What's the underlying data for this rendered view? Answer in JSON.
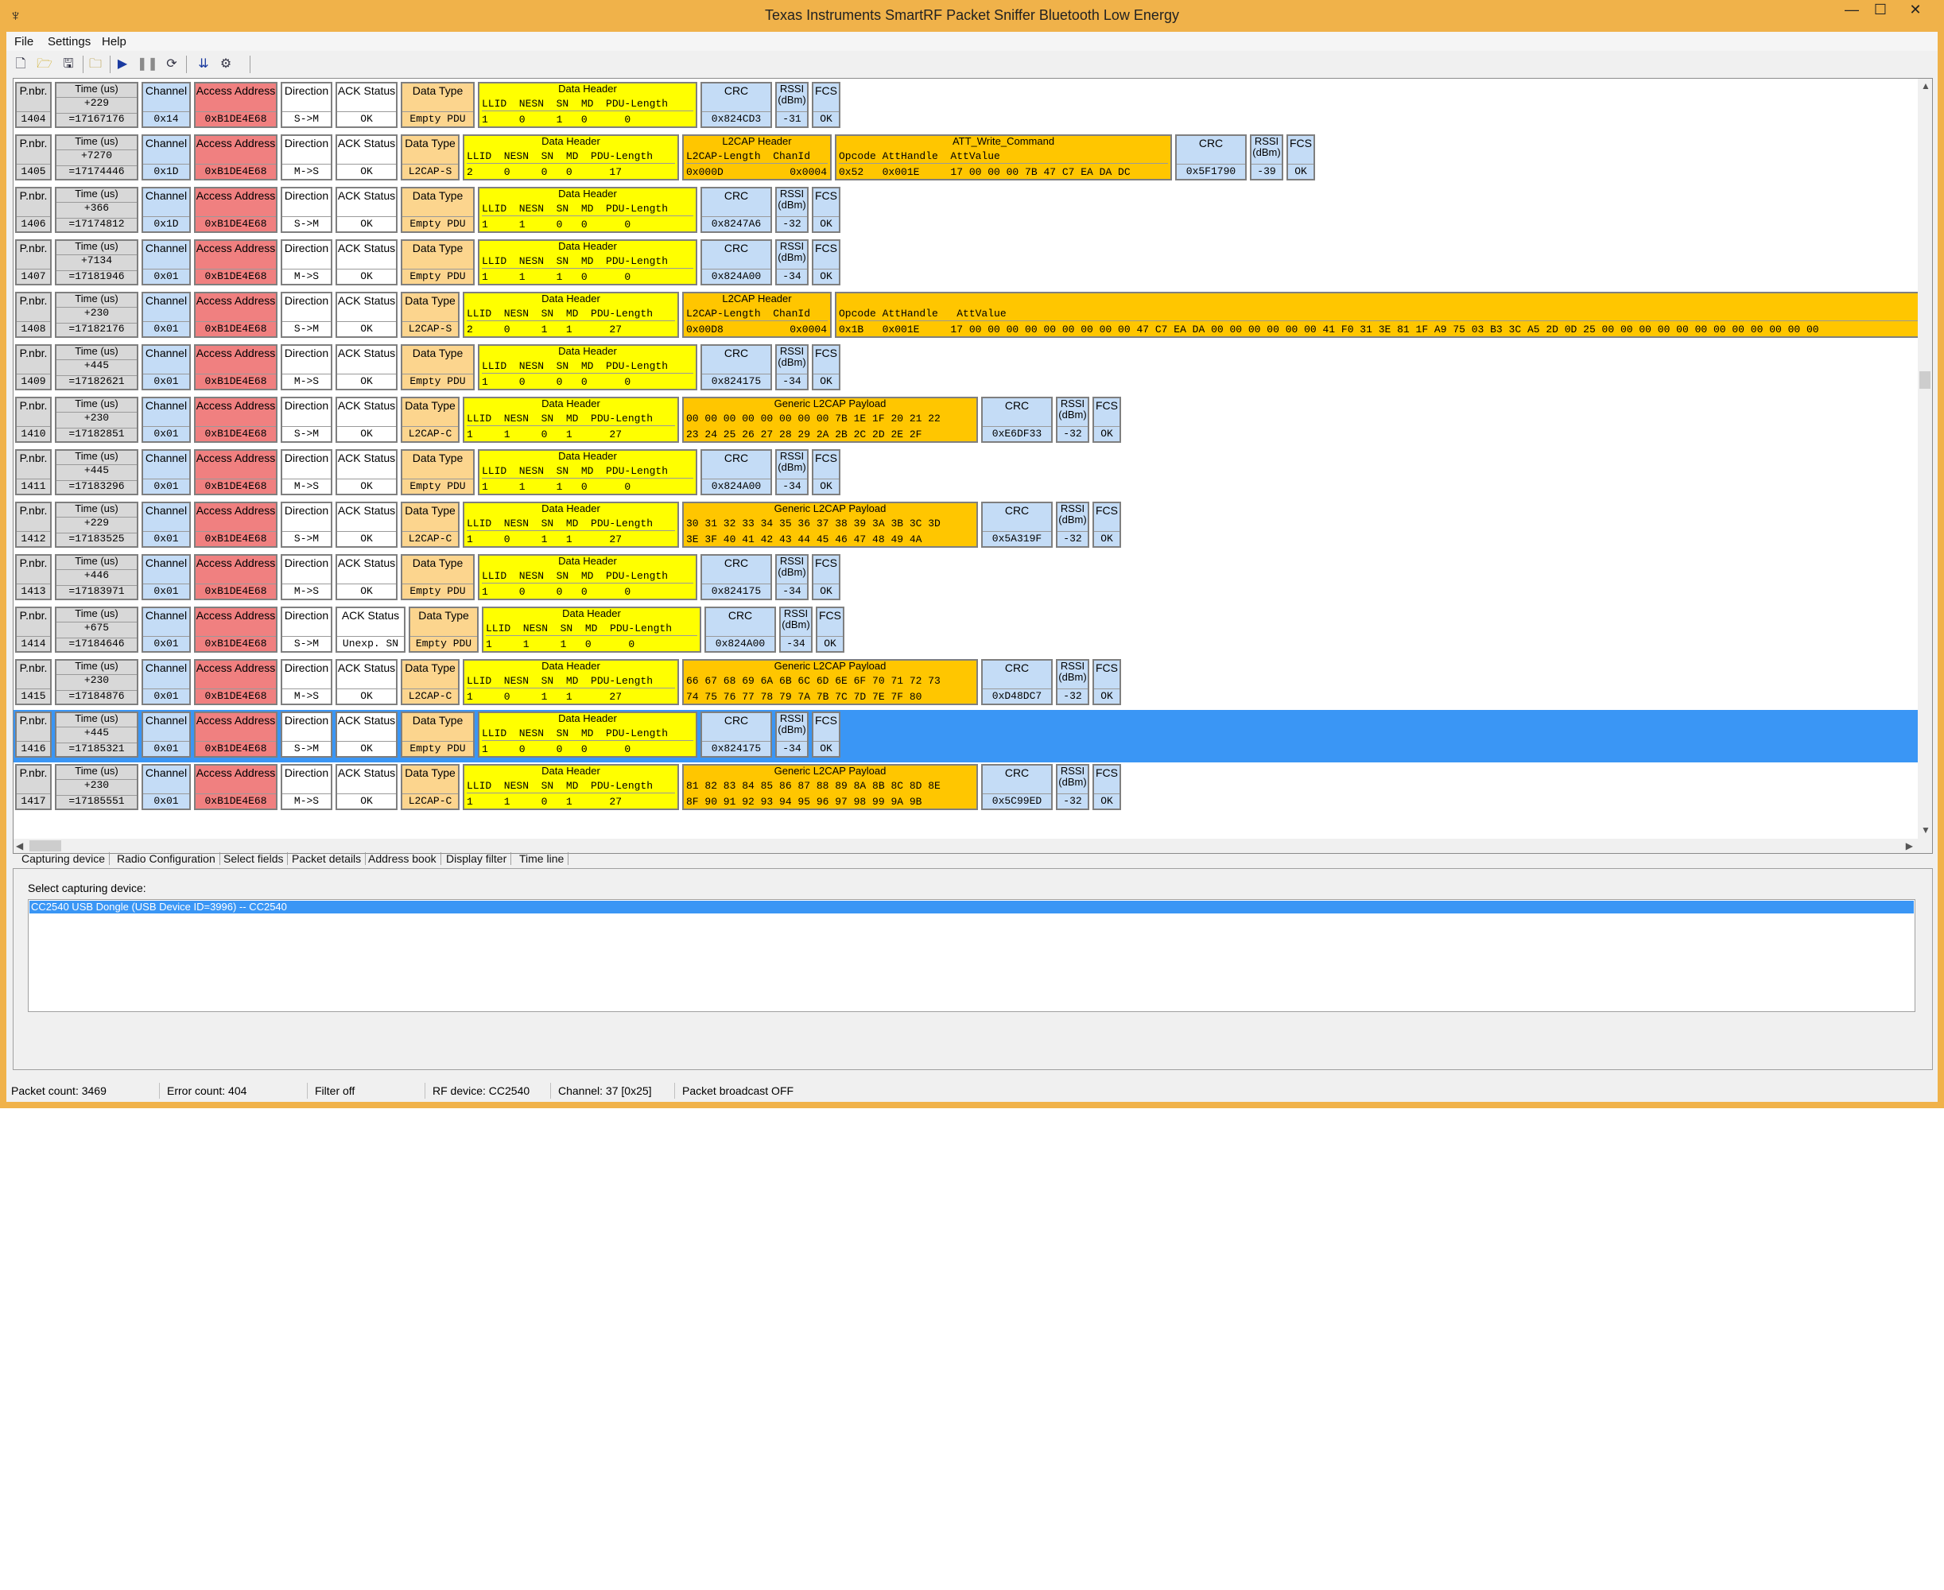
{
  "window": {
    "title": "Texas Instruments SmartRF Packet Sniffer Bluetooth Low Energy",
    "minimize": "—",
    "maximize": "☐",
    "close": "✕"
  },
  "menu": [
    "File",
    "Settings",
    "Help"
  ],
  "toolbar_icons": [
    "new-file-icon",
    "open-folder-icon",
    "save-icon",
    "open-icon",
    "play-icon",
    "pause-icon",
    "clear-icon",
    "autoscroll-icon",
    "setup-icon"
  ],
  "headers": {
    "pnbr": "P.nbr.",
    "time": "Time (us)",
    "channel": "Channel",
    "access": "Access Address",
    "direction": "Direction",
    "ack": "ACK Status",
    "dtype": "Data Type",
    "dheader": "Data Header",
    "dheader_fields": "LLID  NESN  SN  MD  PDU-Length",
    "crc": "CRC",
    "rssi1": "RSSI",
    "rssi2": "(dBm)",
    "fcs": "FCS",
    "l2cap_header": "L2CAP Header",
    "l2cap_fields": "L2CAP-Length  ChanId",
    "generic_l2cap": "Generic L2CAP Payload",
    "att_write": "ATT_Write_Command",
    "att_fields": "Opcode AttHandle  AttValue",
    "att_fields2": "Opcode AttHandle   AttValue"
  },
  "packets": [
    {
      "nbr": "1404",
      "delta": "+229",
      "abs": "=17167176",
      "channel": "0x14",
      "access": "0xB1DE4E68",
      "dir": "S->M",
      "ack": "OK",
      "dtype": "Empty PDU",
      "dh": "1     0     1   0      0",
      "crc": "0x824CD3",
      "rssi": "-31",
      "fcs": "OK"
    },
    {
      "nbr": "1405",
      "delta": "+7270",
      "abs": "=17174446",
      "channel": "0x1D",
      "access": "0xB1DE4E68",
      "dir": "M->S",
      "ack": "OK",
      "dtype": "L2CAP-S",
      "dh": "2     0     0   0      17",
      "l2len": "0x000D",
      "chanid": "0x0004",
      "att": "0x52   0x001E     17 00 00 00 7B 47 C7 EA DA DC",
      "crc": "0x5F1790",
      "rssi": "-39",
      "fcs": "OK"
    },
    {
      "nbr": "1406",
      "delta": "+366",
      "abs": "=17174812",
      "channel": "0x1D",
      "access": "0xB1DE4E68",
      "dir": "S->M",
      "ack": "OK",
      "dtype": "Empty PDU",
      "dh": "1     1     0   0      0",
      "crc": "0x8247A6",
      "rssi": "-32",
      "fcs": "OK"
    },
    {
      "nbr": "1407",
      "delta": "+7134",
      "abs": "=17181946",
      "channel": "0x01",
      "access": "0xB1DE4E68",
      "dir": "M->S",
      "ack": "OK",
      "dtype": "Empty PDU",
      "dh": "1     1     1   0      0",
      "crc": "0x824A00",
      "rssi": "-34",
      "fcs": "OK"
    },
    {
      "nbr": "1408",
      "delta": "+230",
      "abs": "=17182176",
      "channel": "0x01",
      "access": "0xB1DE4E68",
      "dir": "S->M",
      "ack": "OK",
      "dtype": "L2CAP-S",
      "dh": "2     0     1   1      27",
      "l2len": "0x00D8",
      "chanid": "0x0004",
      "att": "0x1B   0x001E     17 00 00 00 00 00 00 00 00 00 47 C7 EA DA 00 00 00 00 00 00 41 F0 31 3E 81 1F A9 75 03 B3 3C A5 2D 0D 25 00 00 00 00 00 00 00 00 00 00 00 00",
      "crc": "",
      "rssi": "",
      "fcs": ""
    },
    {
      "nbr": "1409",
      "delta": "+445",
      "abs": "=17182621",
      "channel": "0x01",
      "access": "0xB1DE4E68",
      "dir": "M->S",
      "ack": "OK",
      "dtype": "Empty PDU",
      "dh": "1     0     0   0      0",
      "crc": "0x824175",
      "rssi": "-34",
      "fcs": "OK"
    },
    {
      "nbr": "1410",
      "delta": "+230",
      "abs": "=17182851",
      "channel": "0x01",
      "access": "0xB1DE4E68",
      "dir": "S->M",
      "ack": "OK",
      "dtype": "L2CAP-C",
      "dh": "1     1     0   1      27",
      "p1": "00 00 00 00 00 00 00 00 7B 1E 1F 20 21 22",
      "p2": "23 24 25 26 27 28 29 2A 2B 2C 2D 2E 2F",
      "crc": "0xE6DF33",
      "rssi": "-32",
      "fcs": "OK"
    },
    {
      "nbr": "1411",
      "delta": "+445",
      "abs": "=17183296",
      "channel": "0x01",
      "access": "0xB1DE4E68",
      "dir": "M->S",
      "ack": "OK",
      "dtype": "Empty PDU",
      "dh": "1     1     1   0      0",
      "crc": "0x824A00",
      "rssi": "-34",
      "fcs": "OK"
    },
    {
      "nbr": "1412",
      "delta": "+229",
      "abs": "=17183525",
      "channel": "0x01",
      "access": "0xB1DE4E68",
      "dir": "S->M",
      "ack": "OK",
      "dtype": "L2CAP-C",
      "dh": "1     0     1   1      27",
      "p1": "30 31 32 33 34 35 36 37 38 39 3A 3B 3C 3D",
      "p2": "3E 3F 40 41 42 43 44 45 46 47 48 49 4A",
      "crc": "0x5A319F",
      "rssi": "-32",
      "fcs": "OK"
    },
    {
      "nbr": "1413",
      "delta": "+446",
      "abs": "=17183971",
      "channel": "0x01",
      "access": "0xB1DE4E68",
      "dir": "M->S",
      "ack": "OK",
      "dtype": "Empty PDU",
      "dh": "1     0     0   0      0",
      "crc": "0x824175",
      "rssi": "-34",
      "fcs": "OK"
    },
    {
      "nbr": "1414",
      "delta": "+675",
      "abs": "=17184646",
      "channel": "0x01",
      "access": "0xB1DE4E68",
      "dir": "S->M",
      "ack": "Unexp. SN",
      "dtype": "Empty PDU",
      "dh": "1     1     1   0      0",
      "crc": "0x824A00",
      "rssi": "-34",
      "fcs": "OK"
    },
    {
      "nbr": "1415",
      "delta": "+230",
      "abs": "=17184876",
      "channel": "0x01",
      "access": "0xB1DE4E68",
      "dir": "M->S",
      "ack": "OK",
      "dtype": "L2CAP-C",
      "dh": "1     0     1   1      27",
      "p1": "66 67 68 69 6A 6B 6C 6D 6E 6F 70 71 72 73",
      "p2": "74 75 76 77 78 79 7A 7B 7C 7D 7E 7F 80",
      "crc": "0xD48DC7",
      "rssi": "-32",
      "fcs": "OK"
    },
    {
      "nbr": "1416",
      "delta": "+445",
      "abs": "=17185321",
      "channel": "0x01",
      "access": "0xB1DE4E68",
      "dir": "S->M",
      "ack": "OK",
      "dtype": "Empty PDU",
      "dh": "1     0     0   0      0",
      "crc": "0x824175",
      "rssi": "-34",
      "fcs": "OK"
    },
    {
      "nbr": "1417",
      "delta": "+230",
      "abs": "=17185551",
      "channel": "0x01",
      "access": "0xB1DE4E68",
      "dir": "M->S",
      "ack": "OK",
      "dtype": "L2CAP-C",
      "dh": "1     1     0   1      27",
      "p1": "81 82 83 84 85 86 87 88 89 8A 8B 8C 8D 8E",
      "p2": "8F 90 91 92 93 94 95 96 97 98 99 9A 9B",
      "crc": "0x5C99ED",
      "rssi": "-32",
      "fcs": "OK"
    }
  ],
  "tabs": [
    "Capturing device",
    "Radio Configuration",
    "Select fields",
    "Packet details",
    "Address book",
    "Display filter",
    "Time line"
  ],
  "device_panel": {
    "label": "Select capturing device:",
    "selected": "CC2540 USB Dongle (USB Device ID=3996) -- CC2540"
  },
  "status": {
    "packet_count": "Packet count: 3469",
    "error_count": "Error count: 404",
    "filter": "Filter off",
    "rf_device": "RF device: CC2540",
    "channel": "Channel: 37 [0x25]",
    "broadcast": "Packet broadcast OFF"
  }
}
